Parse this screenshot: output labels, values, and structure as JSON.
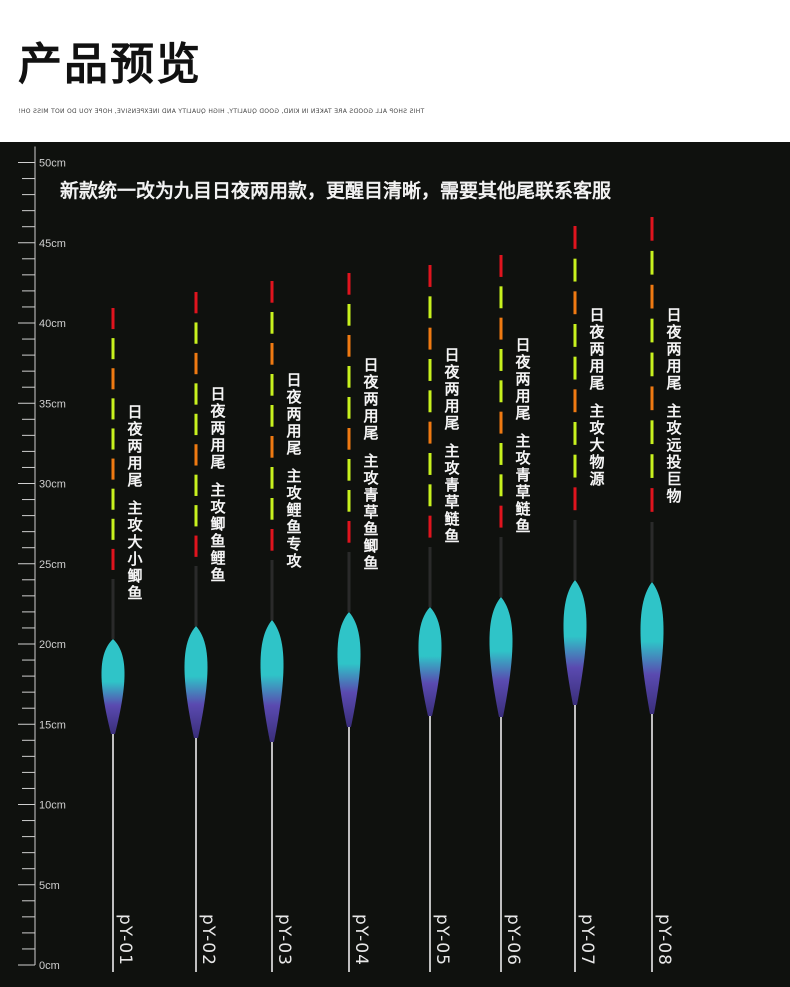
{
  "header": {
    "title": "产品预览",
    "subtitle": "THIS SHOP ALL GOODS ARE TAKEN IN KIND, GOOD QUALITY, HIGH QUALITY AND INEXPENSIVE, HOPE YOU DO NOT MISS OH!"
  },
  "notice": "新款统一改为九目日夜两用款，更醒目清晰，需要其他尾联系客服",
  "ruler": {
    "labels": [
      "50cm",
      "45cm",
      "40cm",
      "35cm",
      "30cm",
      "25cm",
      "20cm",
      "15cm",
      "10cm",
      "5cm",
      "0cm"
    ]
  },
  "floats": [
    {
      "model": "pY-01",
      "line1": "日夜两用尾",
      "line2": "主攻大小鲫鱼"
    },
    {
      "model": "pY-02",
      "line1": "日夜两用尾",
      "line2": "主攻鲫鱼鲤鱼"
    },
    {
      "model": "pY-03",
      "line1": "日夜两用尾",
      "line2": "主攻鲤鱼专攻"
    },
    {
      "model": "pY-04",
      "line1": "日夜两用尾",
      "line2": "主攻青草鱼鲫鱼"
    },
    {
      "model": "pY-05",
      "line1": "日夜两用尾",
      "line2": "主攻青草鲢鱼"
    },
    {
      "model": "pY-06",
      "line1": "日夜两用尾",
      "line2": "主攻青草鲢鱼"
    },
    {
      "model": "pY-07",
      "line1": "日夜两用尾",
      "line2": "主攻大物源"
    },
    {
      "model": "pY-08",
      "line1": "日夜两用尾",
      "line2": "主攻远投巨物"
    }
  ],
  "colors": {
    "panel_bg": "#0f110e",
    "tail_red": "#e0141e",
    "tail_green": "#c8f21e",
    "tail_orange": "#f07a12",
    "body_teal": "#2fc4c8",
    "body_purple": "#5a4ab0"
  }
}
